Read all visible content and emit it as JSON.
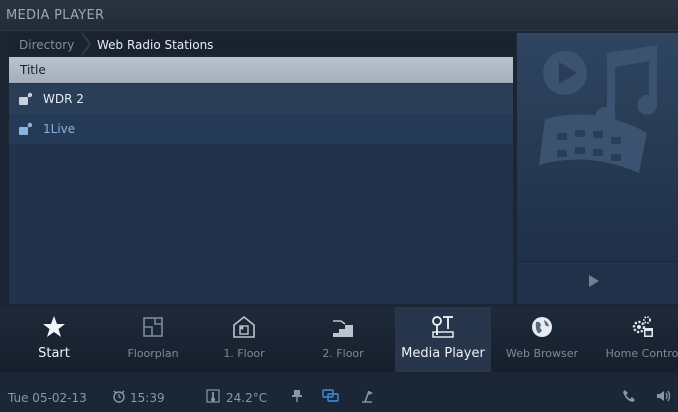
{
  "window": {
    "title": "MEDIA PLAYER"
  },
  "breadcrumb": {
    "items": [
      "Directory",
      "Web Radio Stations"
    ]
  },
  "list": {
    "header": "Title",
    "items": [
      {
        "label": "WDR 2",
        "icon": "radio-station-icon"
      },
      {
        "label": "1Live",
        "icon": "radio-station-icon"
      }
    ]
  },
  "player": {
    "art_icon": "media-artwork-icon",
    "play_icon": "play-icon"
  },
  "dock": {
    "items": [
      {
        "label": "Start",
        "icon": "star-icon"
      },
      {
        "label": "Floorplan",
        "icon": "floorplan-icon"
      },
      {
        "label": "1. Floor",
        "icon": "house-floor-icon"
      },
      {
        "label": "2. Floor",
        "icon": "stairs-icon"
      },
      {
        "label": "Media Player",
        "icon": "media-player-icon"
      },
      {
        "label": "Web Browser",
        "icon": "globe-icon"
      },
      {
        "label": "Home Contro",
        "icon": "gears-calendar-icon"
      }
    ]
  },
  "status": {
    "date": "Tue 05-02-13",
    "time": "15:39",
    "temperature": "24.2°C"
  },
  "colors": {
    "accent": "#3f8fd8",
    "selected_row": "#2a3e58"
  }
}
